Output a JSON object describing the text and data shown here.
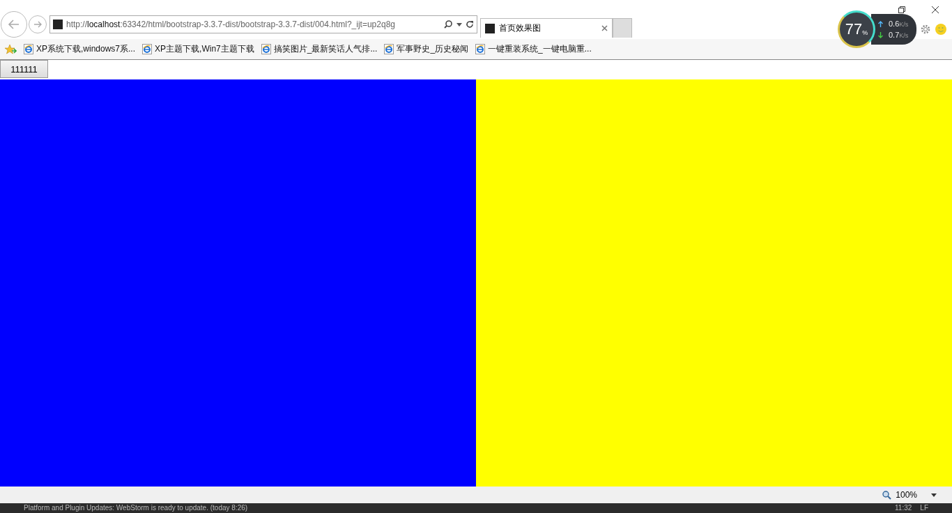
{
  "address_bar": {
    "url_prefix": "http://",
    "url_host": "localhost",
    "url_rest": ":63342/html/bootstrap-3.3.7-dist/bootstrap-3.3.7-dist/004.html?_ijt=up2q8g"
  },
  "tabs": [
    {
      "label": "首页效果图",
      "selected": true
    }
  ],
  "favorites": [
    {
      "label": "XP系统下载,windows7系..."
    },
    {
      "label": "XP主题下载,Win7主题下载"
    },
    {
      "label": "搞笑图片_最新笑话人气排..."
    },
    {
      "label": "军事野史_历史秘闻"
    },
    {
      "label": "一键重装系统_一键电脑重..."
    }
  ],
  "net_monitor": {
    "percent": "77",
    "percent_unit": "%",
    "upload": "0.6",
    "upload_unit": "K/s",
    "download": "0.7",
    "download_unit": "K/s"
  },
  "page": {
    "button": "111111",
    "panels": [
      {
        "color": "#0000ff"
      },
      {
        "color": "#ffff00"
      }
    ]
  },
  "status_bar": {
    "zoom": "100%"
  },
  "ide_bar": {
    "message": "Platform and Plugin Updates: WebStorm is ready to update. (today 8:26)",
    "position": "11:32",
    "line_sep": "LF"
  }
}
